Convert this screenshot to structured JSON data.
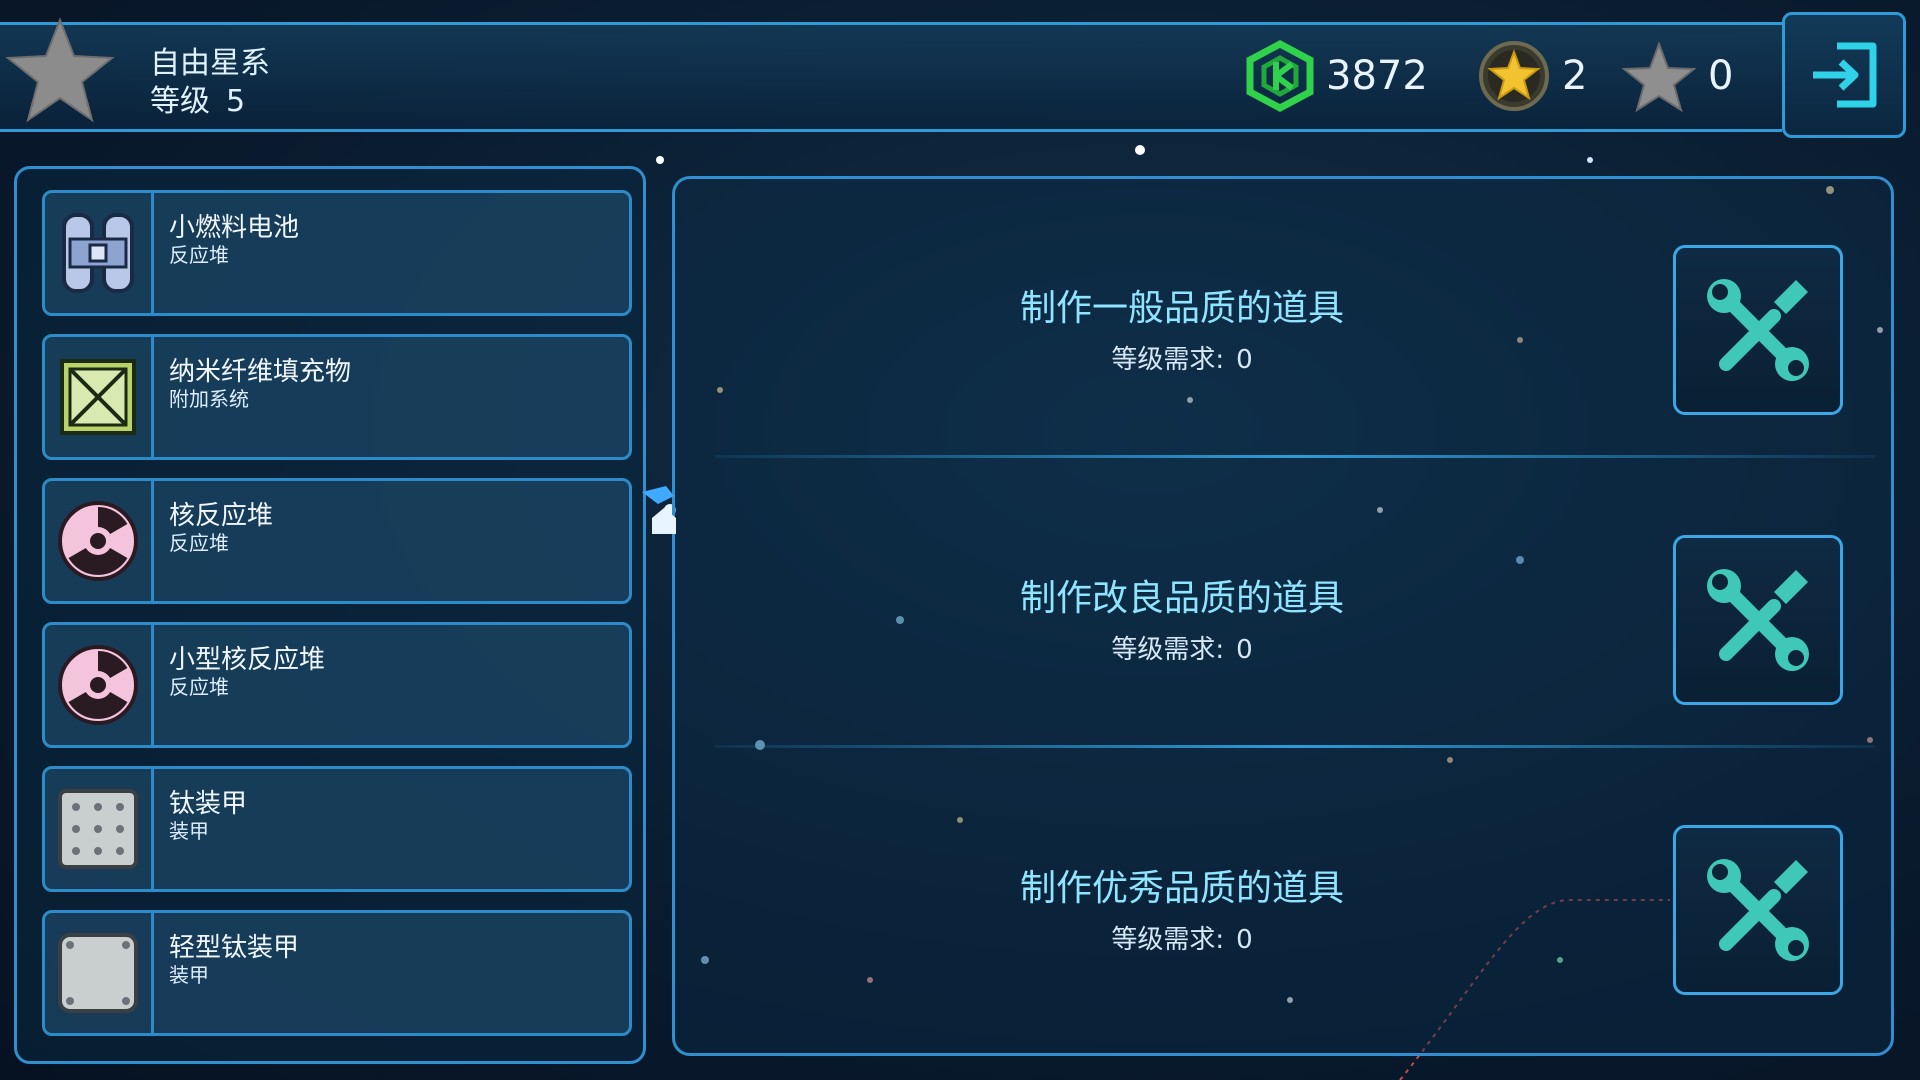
{
  "header": {
    "system_name": "自由星系",
    "level_label": "等级",
    "level_value": "5",
    "currency_value": "3872",
    "gold_star_value": "2",
    "star_value": "0"
  },
  "icons": {
    "rank": "rank-star-icon",
    "currency": "hex-credit-icon",
    "gold_star": "gold-star-medal-icon",
    "star": "star-icon",
    "exit": "exit-icon"
  },
  "items": [
    {
      "name": "小燃料电池",
      "category": "反应堆",
      "icon": "fuel-cell-icon"
    },
    {
      "name": "纳米纤维填充物",
      "category": "附加系统",
      "icon": "nanofiber-crate-icon"
    },
    {
      "name": "核反应堆",
      "category": "反应堆",
      "icon": "radiation-icon"
    },
    {
      "name": "小型核反应堆",
      "category": "反应堆",
      "icon": "radiation-icon"
    },
    {
      "name": "钛装甲",
      "category": "装甲",
      "icon": "armor-plate-icon"
    },
    {
      "name": "轻型钛装甲",
      "category": "装甲",
      "icon": "light-armor-plate-icon"
    }
  ],
  "crafting": [
    {
      "title": "制作一般品质的道具",
      "req_label": "等级需求:",
      "req_value": "0",
      "button_icon": "wrench-screwdriver-icon"
    },
    {
      "title": "制作改良品质的道具",
      "req_label": "等级需求:",
      "req_value": "0",
      "button_icon": "wrench-screwdriver-icon"
    },
    {
      "title": "制作优秀品质的道具",
      "req_label": "等级需求:",
      "req_value": "0",
      "button_icon": "wrench-screwdriver-icon"
    }
  ],
  "colors": {
    "accent": "#2f9bd6",
    "craft_title": "#8fe4ff",
    "currency_green": "#2fd24a",
    "tool_teal": "#3fc7b8"
  }
}
